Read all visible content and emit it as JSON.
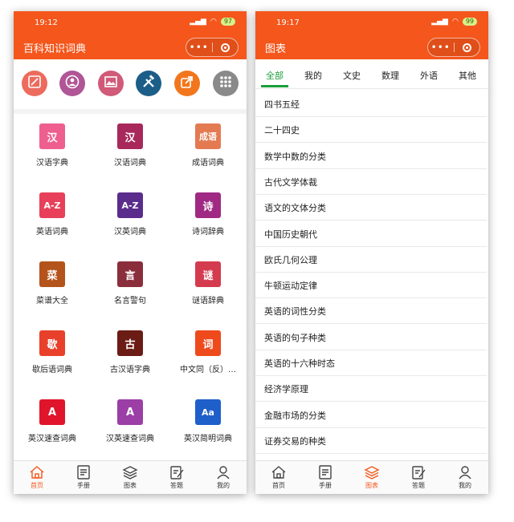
{
  "left_screen": {
    "status": {
      "time": "19:12",
      "battery": "97"
    },
    "nav_title": "百科知识词典",
    "capsule": {
      "more": "•••"
    },
    "shortcuts": [
      {
        "name": "pen-icon",
        "color": "#ec6b5e"
      },
      {
        "name": "profile-icon",
        "color": "#b05596"
      },
      {
        "name": "picture-icon",
        "color": "#d05a78"
      },
      {
        "name": "tools-icon",
        "color": "#1c5e87"
      },
      {
        "name": "share-icon",
        "color": "#f2761d"
      },
      {
        "name": "apps-grid-icon",
        "color": "#8a8a8a"
      }
    ],
    "dictionaries": [
      {
        "label": "汉语字典",
        "glyph": "汉",
        "color": "#ee5f8f",
        "icon": "hanzi-dictionary-icon"
      },
      {
        "label": "汉语词典",
        "glyph": "汉",
        "color": "#a8285c",
        "icon": "chinese-words-icon"
      },
      {
        "label": "成语词典",
        "glyph": "成语",
        "color": "#e47a52",
        "icon": "idiom-book-icon"
      },
      {
        "label": "英语词典",
        "glyph": "A-Z",
        "color": "#e8405a",
        "icon": "english-dictionary-icon"
      },
      {
        "label": "汉英词典",
        "glyph": "A-Z",
        "color": "#5a2d8c",
        "icon": "chinese-english-icon"
      },
      {
        "label": "诗词辞典",
        "glyph": "诗",
        "color": "#a02a83",
        "icon": "poetry-icon"
      },
      {
        "label": "菜谱大全",
        "glyph": "菜",
        "color": "#b4531b",
        "icon": "recipe-icon"
      },
      {
        "label": "名言警句",
        "glyph": "言",
        "color": "#8a2e3c",
        "icon": "quotes-icon"
      },
      {
        "label": "谜语辞典",
        "glyph": "谜",
        "color": "#d43b4f",
        "icon": "riddle-icon"
      },
      {
        "label": "歇后语词典",
        "glyph": "歇",
        "color": "#e8402a",
        "icon": "xiehouyu-icon"
      },
      {
        "label": "古汉语字典",
        "glyph": "古",
        "color": "#6a1c15",
        "icon": "ancient-chinese-icon"
      },
      {
        "label": "中文同（反）…",
        "glyph": "词",
        "color": "#ef4a1c",
        "icon": "synonym-icon"
      },
      {
        "label": "英汉速查词典",
        "glyph": "A",
        "color": "#e0152b",
        "icon": "english-chinese-quick-icon"
      },
      {
        "label": "汉英速查词典",
        "glyph": "A",
        "color": "#9b3ea6",
        "icon": "chinese-english-quick-icon"
      },
      {
        "label": "英汉简明词典",
        "glyph": "Aa",
        "color": "#1f5fc9",
        "icon": "concise-dictionary-icon"
      }
    ],
    "tabs": [
      {
        "label": "首页",
        "icon": "home-icon",
        "active": true
      },
      {
        "label": "手册",
        "icon": "manual-icon",
        "active": false
      },
      {
        "label": "图表",
        "icon": "layers-icon",
        "active": false
      },
      {
        "label": "答题",
        "icon": "quiz-icon",
        "active": false
      },
      {
        "label": "我的",
        "icon": "profile-icon",
        "active": false
      }
    ]
  },
  "right_screen": {
    "status": {
      "time": "19:17",
      "battery": "99"
    },
    "nav_title": "图表",
    "capsule": {
      "more": "•••"
    },
    "categories": [
      {
        "label": "全部",
        "active": true
      },
      {
        "label": "我的",
        "active": false
      },
      {
        "label": "文史",
        "active": false
      },
      {
        "label": "数理",
        "active": false
      },
      {
        "label": "外语",
        "active": false
      },
      {
        "label": "其他",
        "active": false
      }
    ],
    "topics": [
      "四书五经",
      "二十四史",
      "数学中数的分类",
      "古代文学体裁",
      "语文的文体分类",
      "中国历史朝代",
      "欧氏几何公理",
      "牛顿运动定律",
      "英语的词性分类",
      "英语的句子种类",
      "英语的十六种时态",
      "经济学原理",
      "金融市场的分类",
      "证券交易的种类"
    ],
    "tabs": [
      {
        "label": "首页",
        "icon": "home-icon",
        "active": false
      },
      {
        "label": "手册",
        "icon": "manual-icon",
        "active": false
      },
      {
        "label": "图表",
        "icon": "layers-icon",
        "active": true
      },
      {
        "label": "答题",
        "icon": "quiz-icon",
        "active": false
      },
      {
        "label": "我的",
        "icon": "profile-icon",
        "active": false
      }
    ]
  },
  "colors": {
    "brand": "#f4561c",
    "active_category": "#1a9e3a"
  }
}
